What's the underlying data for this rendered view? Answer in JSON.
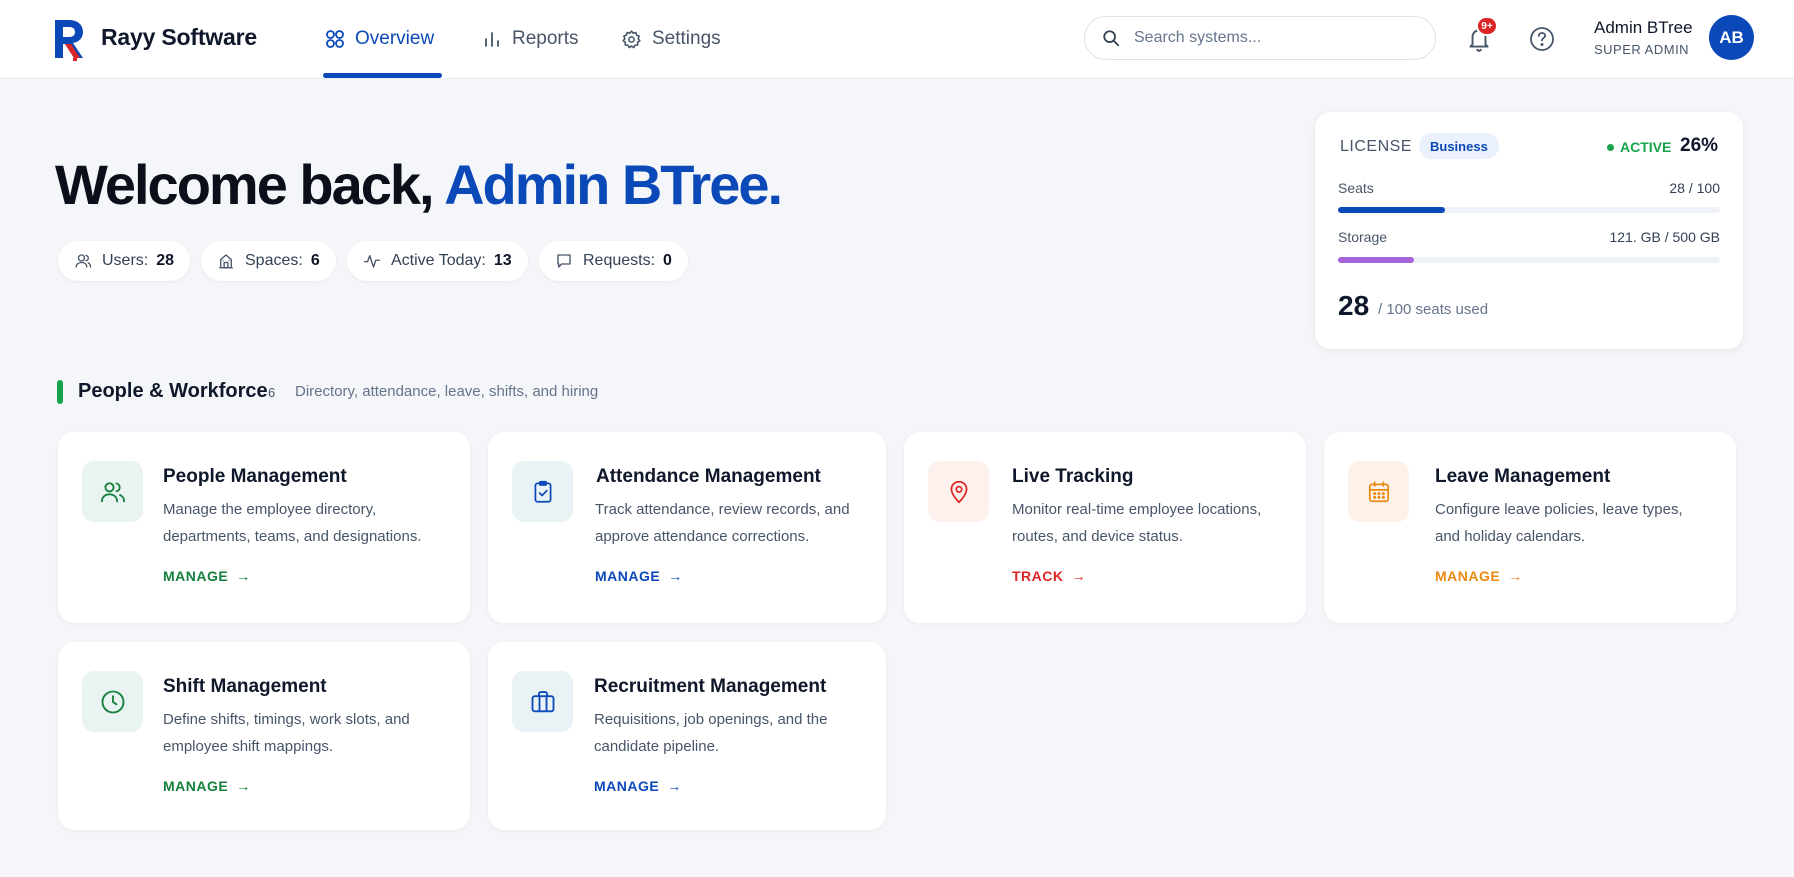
{
  "header": {
    "brand": "Rayy Software",
    "nav": [
      {
        "label": "Overview",
        "icon": "grid-icon",
        "active": true
      },
      {
        "label": "Reports",
        "icon": "bar-chart-icon",
        "active": false
      },
      {
        "label": "Settings",
        "icon": "gear-icon",
        "active": false
      }
    ],
    "search_placeholder": "Search systems...",
    "notification_badge": "9+",
    "user": {
      "name": "Admin BTree",
      "role": "SUPER ADMIN",
      "initials": "AB"
    }
  },
  "welcome": {
    "prefix": "Welcome back, ",
    "name": "Admin BTree."
  },
  "stats": [
    {
      "label": "Users:",
      "value": "28",
      "icon": "users-icon"
    },
    {
      "label": "Spaces:",
      "value": "6",
      "icon": "building-icon"
    },
    {
      "label": "Active Today:",
      "value": "13",
      "icon": "activity-icon"
    },
    {
      "label": "Requests:",
      "value": "0",
      "icon": "message-icon"
    }
  ],
  "license": {
    "title": "LICENSE",
    "tier": "Business",
    "status": "ACTIVE",
    "percent": "26%",
    "seats_label": "Seats",
    "seats_value": "28 / 100",
    "seats_fraction": 0.28,
    "storage_label": "Storage",
    "storage_value": "121. GB / 500 GB",
    "storage_fraction": 0.2,
    "big_number": "28",
    "big_sub": "/ 100 seats used"
  },
  "section": {
    "title": "People & Workforce",
    "count": "6",
    "description": "Directory, attendance, leave, shifts, and hiring"
  },
  "cards": [
    {
      "title": "People Management",
      "desc": "Manage the employee directory, departments, teams, and designations.",
      "action": "MANAGE",
      "icon": "users-icon",
      "accent": "#15803d",
      "icon_bg": "#e9f3f1"
    },
    {
      "title": "Attendance Management",
      "desc": "Track attendance, review records, and approve attendance corrections.",
      "action": "MANAGE",
      "icon": "clipboard-check-icon",
      "accent": "#0b49b8",
      "icon_bg": "#e9f3f5"
    },
    {
      "title": "Live Tracking",
      "desc": "Monitor real-time employee locations, routes, and device status.",
      "action": "TRACK",
      "icon": "map-pin-icon",
      "accent": "#dc2626",
      "icon_bg": "#fdf0ed"
    },
    {
      "title": "Leave Management",
      "desc": "Configure leave policies, leave types, and holiday calendars.",
      "action": "MANAGE",
      "icon": "calendar-icon",
      "accent": "#ea8a12",
      "icon_bg": "#fdf1e8"
    },
    {
      "title": "Shift Management",
      "desc": "Define shifts, timings, work slots, and employee shift mappings.",
      "action": "MANAGE",
      "icon": "clock-icon",
      "accent": "#15803d",
      "icon_bg": "#e9f3f1"
    },
    {
      "title": "Recruitment Management",
      "desc": "Requisitions, job openings, and the candidate pipeline.",
      "action": "MANAGE",
      "icon": "briefcase-icon",
      "accent": "#0b49b8",
      "icon_bg": "#e9f3f5"
    }
  ]
}
